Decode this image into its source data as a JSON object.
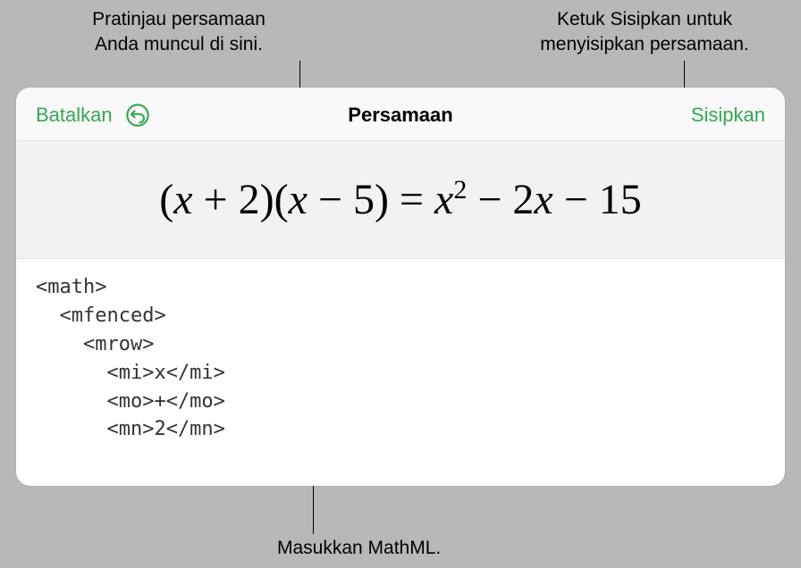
{
  "callouts": {
    "preview_line1": "Pratinjau persamaan",
    "preview_line2": "Anda muncul di sini.",
    "insert_line1": "Ketuk Sisipkan untuk",
    "insert_line2": "menyisipkan persamaan.",
    "mathml": "Masukkan MathML."
  },
  "dialog": {
    "cancel_label": "Batalkan",
    "title": "Persamaan",
    "insert_label": "Sisipkan"
  },
  "equation": {
    "display": "(x + 2)(x − 5) = x² − 2x − 15"
  },
  "code": {
    "l1": "<math>",
    "l2": "  <mfenced>",
    "l3": "    <mrow>",
    "l4": "      <mi>x</mi>",
    "l5": "      <mo>+</mo>",
    "l6": "      <mn>2</mn>"
  }
}
